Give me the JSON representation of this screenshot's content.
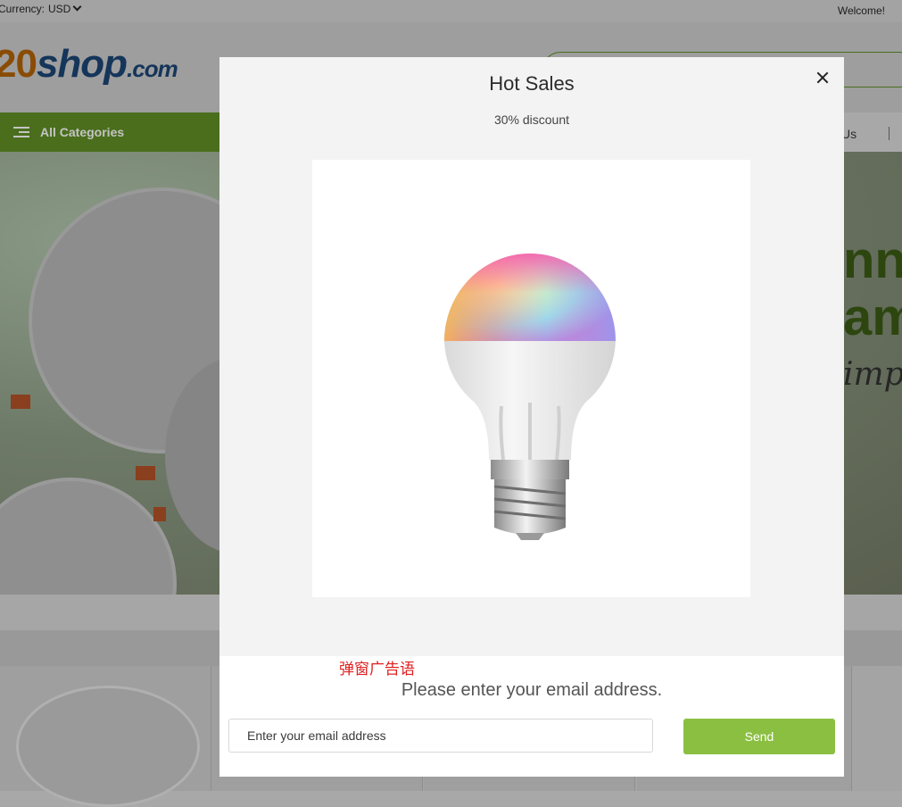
{
  "topbar": {
    "currency_label": "Currency:",
    "currency_value": "USD",
    "welcome": "Welcome!"
  },
  "logo": {
    "part1": "20",
    "part2": "shop",
    "part3": ".com"
  },
  "nav": {
    "all_categories": "All Categories",
    "link_partial": "Us"
  },
  "banner": {
    "line1": "nn",
    "line2": "am",
    "line3": "impu"
  },
  "popup": {
    "title": "Hot Sales",
    "subtitle": "30% discount",
    "ad_text": "弹窗广告语",
    "prompt": "Please enter your email address.",
    "email_placeholder": "Enter your email address",
    "send_label": "Send"
  },
  "colors": {
    "send_button": "#8bbf42",
    "ad_text": "#e02020",
    "nav_green": "#7cb342"
  }
}
